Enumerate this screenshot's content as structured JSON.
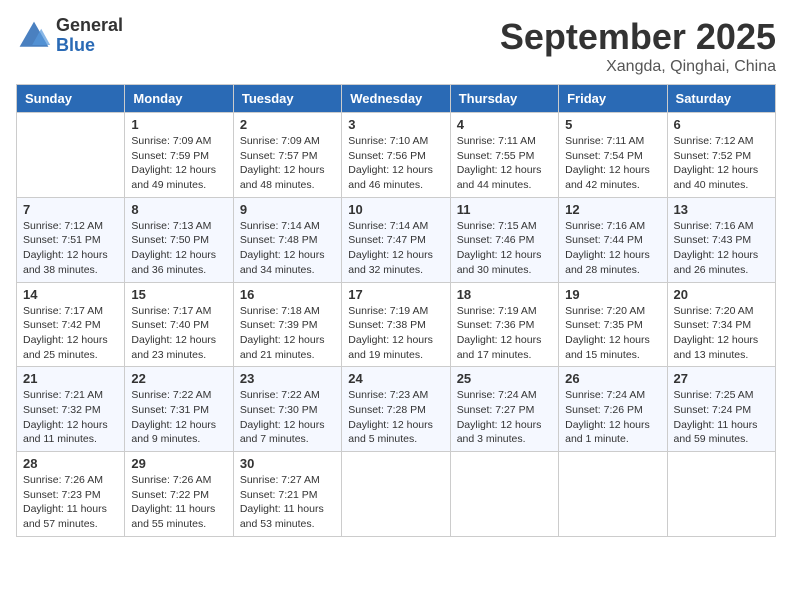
{
  "header": {
    "logo_general": "General",
    "logo_blue": "Blue",
    "month": "September 2025",
    "location": "Xangda, Qinghai, China"
  },
  "days_of_week": [
    "Sunday",
    "Monday",
    "Tuesday",
    "Wednesday",
    "Thursday",
    "Friday",
    "Saturday"
  ],
  "weeks": [
    [
      {
        "day": "",
        "sunrise": "",
        "sunset": "",
        "daylight": ""
      },
      {
        "day": "1",
        "sunrise": "Sunrise: 7:09 AM",
        "sunset": "Sunset: 7:59 PM",
        "daylight": "Daylight: 12 hours and 49 minutes."
      },
      {
        "day": "2",
        "sunrise": "Sunrise: 7:09 AM",
        "sunset": "Sunset: 7:57 PM",
        "daylight": "Daylight: 12 hours and 48 minutes."
      },
      {
        "day": "3",
        "sunrise": "Sunrise: 7:10 AM",
        "sunset": "Sunset: 7:56 PM",
        "daylight": "Daylight: 12 hours and 46 minutes."
      },
      {
        "day": "4",
        "sunrise": "Sunrise: 7:11 AM",
        "sunset": "Sunset: 7:55 PM",
        "daylight": "Daylight: 12 hours and 44 minutes."
      },
      {
        "day": "5",
        "sunrise": "Sunrise: 7:11 AM",
        "sunset": "Sunset: 7:54 PM",
        "daylight": "Daylight: 12 hours and 42 minutes."
      },
      {
        "day": "6",
        "sunrise": "Sunrise: 7:12 AM",
        "sunset": "Sunset: 7:52 PM",
        "daylight": "Daylight: 12 hours and 40 minutes."
      }
    ],
    [
      {
        "day": "7",
        "sunrise": "Sunrise: 7:12 AM",
        "sunset": "Sunset: 7:51 PM",
        "daylight": "Daylight: 12 hours and 38 minutes."
      },
      {
        "day": "8",
        "sunrise": "Sunrise: 7:13 AM",
        "sunset": "Sunset: 7:50 PM",
        "daylight": "Daylight: 12 hours and 36 minutes."
      },
      {
        "day": "9",
        "sunrise": "Sunrise: 7:14 AM",
        "sunset": "Sunset: 7:48 PM",
        "daylight": "Daylight: 12 hours and 34 minutes."
      },
      {
        "day": "10",
        "sunrise": "Sunrise: 7:14 AM",
        "sunset": "Sunset: 7:47 PM",
        "daylight": "Daylight: 12 hours and 32 minutes."
      },
      {
        "day": "11",
        "sunrise": "Sunrise: 7:15 AM",
        "sunset": "Sunset: 7:46 PM",
        "daylight": "Daylight: 12 hours and 30 minutes."
      },
      {
        "day": "12",
        "sunrise": "Sunrise: 7:16 AM",
        "sunset": "Sunset: 7:44 PM",
        "daylight": "Daylight: 12 hours and 28 minutes."
      },
      {
        "day": "13",
        "sunrise": "Sunrise: 7:16 AM",
        "sunset": "Sunset: 7:43 PM",
        "daylight": "Daylight: 12 hours and 26 minutes."
      }
    ],
    [
      {
        "day": "14",
        "sunrise": "Sunrise: 7:17 AM",
        "sunset": "Sunset: 7:42 PM",
        "daylight": "Daylight: 12 hours and 25 minutes."
      },
      {
        "day": "15",
        "sunrise": "Sunrise: 7:17 AM",
        "sunset": "Sunset: 7:40 PM",
        "daylight": "Daylight: 12 hours and 23 minutes."
      },
      {
        "day": "16",
        "sunrise": "Sunrise: 7:18 AM",
        "sunset": "Sunset: 7:39 PM",
        "daylight": "Daylight: 12 hours and 21 minutes."
      },
      {
        "day": "17",
        "sunrise": "Sunrise: 7:19 AM",
        "sunset": "Sunset: 7:38 PM",
        "daylight": "Daylight: 12 hours and 19 minutes."
      },
      {
        "day": "18",
        "sunrise": "Sunrise: 7:19 AM",
        "sunset": "Sunset: 7:36 PM",
        "daylight": "Daylight: 12 hours and 17 minutes."
      },
      {
        "day": "19",
        "sunrise": "Sunrise: 7:20 AM",
        "sunset": "Sunset: 7:35 PM",
        "daylight": "Daylight: 12 hours and 15 minutes."
      },
      {
        "day": "20",
        "sunrise": "Sunrise: 7:20 AM",
        "sunset": "Sunset: 7:34 PM",
        "daylight": "Daylight: 12 hours and 13 minutes."
      }
    ],
    [
      {
        "day": "21",
        "sunrise": "Sunrise: 7:21 AM",
        "sunset": "Sunset: 7:32 PM",
        "daylight": "Daylight: 12 hours and 11 minutes."
      },
      {
        "day": "22",
        "sunrise": "Sunrise: 7:22 AM",
        "sunset": "Sunset: 7:31 PM",
        "daylight": "Daylight: 12 hours and 9 minutes."
      },
      {
        "day": "23",
        "sunrise": "Sunrise: 7:22 AM",
        "sunset": "Sunset: 7:30 PM",
        "daylight": "Daylight: 12 hours and 7 minutes."
      },
      {
        "day": "24",
        "sunrise": "Sunrise: 7:23 AM",
        "sunset": "Sunset: 7:28 PM",
        "daylight": "Daylight: 12 hours and 5 minutes."
      },
      {
        "day": "25",
        "sunrise": "Sunrise: 7:24 AM",
        "sunset": "Sunset: 7:27 PM",
        "daylight": "Daylight: 12 hours and 3 minutes."
      },
      {
        "day": "26",
        "sunrise": "Sunrise: 7:24 AM",
        "sunset": "Sunset: 7:26 PM",
        "daylight": "Daylight: 12 hours and 1 minute."
      },
      {
        "day": "27",
        "sunrise": "Sunrise: 7:25 AM",
        "sunset": "Sunset: 7:24 PM",
        "daylight": "Daylight: 11 hours and 59 minutes."
      }
    ],
    [
      {
        "day": "28",
        "sunrise": "Sunrise: 7:26 AM",
        "sunset": "Sunset: 7:23 PM",
        "daylight": "Daylight: 11 hours and 57 minutes."
      },
      {
        "day": "29",
        "sunrise": "Sunrise: 7:26 AM",
        "sunset": "Sunset: 7:22 PM",
        "daylight": "Daylight: 11 hours and 55 minutes."
      },
      {
        "day": "30",
        "sunrise": "Sunrise: 7:27 AM",
        "sunset": "Sunset: 7:21 PM",
        "daylight": "Daylight: 11 hours and 53 minutes."
      },
      {
        "day": "",
        "sunrise": "",
        "sunset": "",
        "daylight": ""
      },
      {
        "day": "",
        "sunrise": "",
        "sunset": "",
        "daylight": ""
      },
      {
        "day": "",
        "sunrise": "",
        "sunset": "",
        "daylight": ""
      },
      {
        "day": "",
        "sunrise": "",
        "sunset": "",
        "daylight": ""
      }
    ]
  ]
}
